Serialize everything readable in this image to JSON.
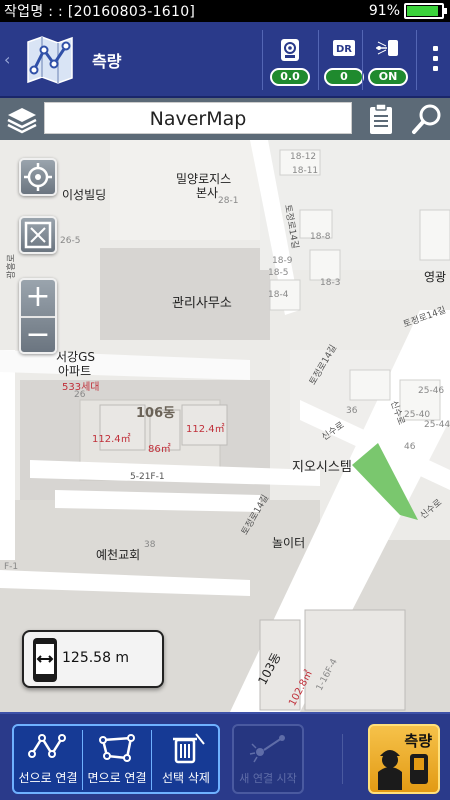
{
  "status_bar": {
    "title": "작업명 : : [20160803-1610]",
    "battery_pct_text": "91%",
    "battery_level": 0.91,
    "battery_color": "#3bd33b"
  },
  "toolbar": {
    "app_title": "측량",
    "gps_value": "0.0",
    "dr_label": "DR",
    "dr_value": "0",
    "laser_value": "ON",
    "icons": [
      "map-logo-icon",
      "gps-receiver-icon",
      "dr-icon",
      "laser-device-icon",
      "overflow-menu-icon"
    ]
  },
  "search": {
    "map_name": "NaverMap",
    "icons": [
      "layers-icon",
      "clipboard-icon",
      "search-icon"
    ]
  },
  "map": {
    "labels": {
      "isung": "이성빌딩",
      "milyang": "밀양로지스",
      "milyang2": "본사",
      "kwanri": "관리사무소",
      "seogang1": "서강GS",
      "seogang2": "아파트",
      "households": "533세대",
      "dong106": "106동",
      "area1": "112.4㎡",
      "area2": "86㎡",
      "area3": "112.4㎡",
      "area4": "102.8㎡",
      "lot": "5-21F-1",
      "jio": "지오시스템",
      "yecheon": "예천교회",
      "noli": "놀이터",
      "dong103": "103동",
      "yeonggwang": "영광",
      "road1": "토정로14길",
      "road2": "토정로14길",
      "road3": "토정로14길",
      "road4": "신수로",
      "road5": "신수로",
      "road6": "토정로14길",
      "road7": "신수로",
      "road8": "광흥로",
      "n18_12": "18-12",
      "n18_11": "18-11",
      "n18_8": "18-8",
      "n18_9": "18-9",
      "n18_5": "18-5",
      "n18_4": "18-4",
      "n18_3": "18-3",
      "n28_1": "28-1",
      "n26_5": "26-5",
      "n25_46": "25-46",
      "n25_40": "25-40",
      "n25_44": "25-44",
      "n26": "26",
      "n38": "38",
      "n36": "36",
      "n46_n": "46",
      "n16F4": "1-16F-4",
      "nF1": "F-1"
    },
    "zoom_in": "+",
    "zoom_out": "−",
    "distance": "125.58 m",
    "park_color": "#7ac76e"
  },
  "bottom": {
    "connect_line": "선으로 연결",
    "connect_area": "면으로 연결",
    "delete_selected": "선택 삭제",
    "new_connection": "새 연결 시작",
    "measure": "측량"
  }
}
